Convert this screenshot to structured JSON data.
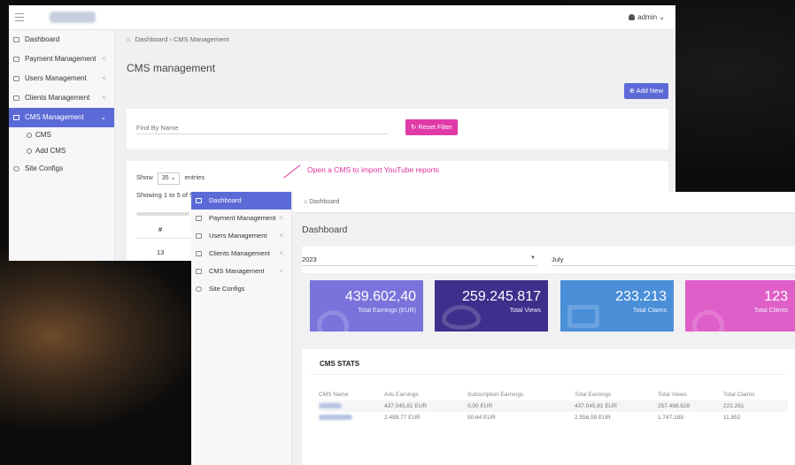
{
  "back_window": {
    "user_label": "admin ⌄",
    "sidebar": [
      {
        "label": "Dashboard",
        "chevron": ""
      },
      {
        "label": "Payment Management",
        "chevron": "<"
      },
      {
        "label": "Users Management",
        "chevron": "<"
      },
      {
        "label": "Clients Management",
        "chevron": "<"
      },
      {
        "label": "CMS Management",
        "chevron": "⌄"
      },
      {
        "label": "Site Configs",
        "chevron": ""
      }
    ],
    "sidebar_sub": [
      "CMS",
      "Add CMS"
    ],
    "breadcrumb_1": "Dashboard",
    "breadcrumb_sep": "›",
    "breadcrumb_2": "CMS Management",
    "page_title": "CMS management",
    "add_new_label": "⊕ Add New",
    "find_placeholder": "Find By Name",
    "reset_filter_label": "↻ Reset Filter",
    "show_label": "Show",
    "show_value": "35",
    "entries_label": "entries",
    "showing_text": "Showing 1 to 5 of 5",
    "col_hash": "#",
    "first_row_id": "13"
  },
  "annotation": "Open a CMS to import YouTube reports",
  "front_window": {
    "sidebar": [
      {
        "label": "Dashboard",
        "chevron": ""
      },
      {
        "label": "Payment Management",
        "chevron": "<"
      },
      {
        "label": "Users Management",
        "chevron": "<"
      },
      {
        "label": "Clients Management",
        "chevron": "<"
      },
      {
        "label": "CMS Management",
        "chevron": "<"
      },
      {
        "label": "Site Configs",
        "chevron": ""
      }
    ],
    "breadcrumb": "Dashboard",
    "page_title": "Dashboard",
    "year_select": "2023",
    "month_select": "July",
    "stats": [
      {
        "value": "439.602,40",
        "label": "Total Earnings (EUR)"
      },
      {
        "value": "259.245.817",
        "label": "Total Views"
      },
      {
        "value": "233.213",
        "label": "Total Claims"
      },
      {
        "value": "123",
        "label": "Total Clients"
      }
    ],
    "cms_stats_title": "CMS STATS",
    "cms_table": {
      "headers": [
        "CMS Name",
        "Ads Earnings",
        "Subscription Earnings",
        "Total Earnings",
        "Total Views",
        "Total Claims"
      ],
      "rows": [
        [
          "",
          "437.045,81 EUR",
          "0,00 EUR",
          "437.045,81 EUR",
          "257.498.628",
          "221.261"
        ],
        [
          "",
          "2.499,77 EUR",
          "50,64 EUR",
          "2.556,59 EUR",
          "1.747.189",
          "11.952"
        ]
      ]
    }
  },
  "colors": {
    "primary": "#5c6ad8",
    "reset": "#e03aa8",
    "annotation": "#e0309f",
    "stat_earnings": "#7b73dc",
    "stat_views": "#3d2f8c",
    "stat_claims": "#4a8fd8",
    "stat_clients": "#df5fc8"
  }
}
